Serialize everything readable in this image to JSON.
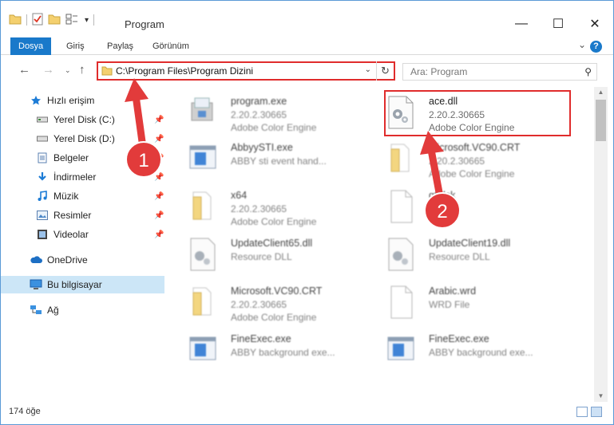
{
  "window": {
    "title": "Program",
    "controls": {
      "minimize": "—",
      "maximize": "☐",
      "close": "✕"
    }
  },
  "ribbon": {
    "tabs": [
      {
        "label": "Dosya",
        "active": true
      },
      {
        "label": "Giriş",
        "active": false
      },
      {
        "label": "Paylaş",
        "active": false
      },
      {
        "label": "Görünüm",
        "active": false
      }
    ],
    "help": "?"
  },
  "address": {
    "path": "C:\\Program Files\\Program Dizini"
  },
  "search": {
    "placeholder": "Ara: Program"
  },
  "sidebar": {
    "items": [
      {
        "label": "Hızlı erişim",
        "icon": "star-icon",
        "pinned": false
      },
      {
        "label": "Yerel Disk (C:)",
        "icon": "drive-icon",
        "pinned": true
      },
      {
        "label": "Yerel Disk (D:)",
        "icon": "drive-icon",
        "pinned": true
      },
      {
        "label": "Belgeler",
        "icon": "documents-icon",
        "pinned": true
      },
      {
        "label": "İndirmeler",
        "icon": "download-icon",
        "pinned": true
      },
      {
        "label": "Müzik",
        "icon": "music-icon",
        "pinned": true
      },
      {
        "label": "Resimler",
        "icon": "pictures-icon",
        "pinned": true
      },
      {
        "label": "Videolar",
        "icon": "video-icon",
        "pinned": true
      },
      {
        "label": "OneDrive",
        "icon": "cloud-icon",
        "pinned": false
      },
      {
        "label": "Bu bilgisayar",
        "icon": "computer-icon",
        "pinned": false,
        "selected": true
      },
      {
        "label": "Ağ",
        "icon": "network-icon",
        "pinned": false
      }
    ]
  },
  "files": [
    {
      "name": "program.exe",
      "line1": "2.20.2.30665",
      "line2": "Adobe Color Engine",
      "icon": "installer-icon"
    },
    {
      "name": "ace.dll",
      "line1": "2.20.2.30665",
      "line2": "Adobe Color Engine",
      "icon": "dll-gear-icon"
    },
    {
      "name": "AbbyySTI.exe",
      "line1": "ABBY sti event hand...",
      "line2": "",
      "icon": "exe-window-icon"
    },
    {
      "name": "Microsoft.VC90.CRT",
      "line1": "2.20.2.30665",
      "line2": "Adobe Color Engine",
      "icon": "folder-icon"
    },
    {
      "name": "x64",
      "line1": "2.20.2.30665",
      "line2": "Adobe Color Engine",
      "icon": "folder-icon"
    },
    {
      "name": "gt.dsk",
      "line1": "",
      "line2": "",
      "icon": "blank-file-icon"
    },
    {
      "name": "UpdateClient65.dll",
      "line1": "Resource DLL",
      "line2": "",
      "icon": "dll-gear-icon"
    },
    {
      "name": "UpdateClient19.dll",
      "line1": "Resource DLL",
      "line2": "",
      "icon": "dll-gear-icon"
    },
    {
      "name": "Microsoft.VC90.CRT",
      "line1": "2.20.2.30665",
      "line2": "Adobe Color Engine",
      "icon": "folder-icon"
    },
    {
      "name": "Arabic.wrd",
      "line1": "WRD File",
      "line2": "",
      "icon": "blank-file-icon"
    },
    {
      "name": "FineExec.exe",
      "line1": "ABBY background exe...",
      "line2": "",
      "icon": "exe-window-icon"
    },
    {
      "name": "FineExec.exe",
      "line1": "ABBY background exe...",
      "line2": "",
      "icon": "exe-window-icon"
    }
  ],
  "status": {
    "count": "174 öğe"
  },
  "annotations": {
    "badge1": "1",
    "badge2": "2",
    "color": "#e23b3b"
  }
}
